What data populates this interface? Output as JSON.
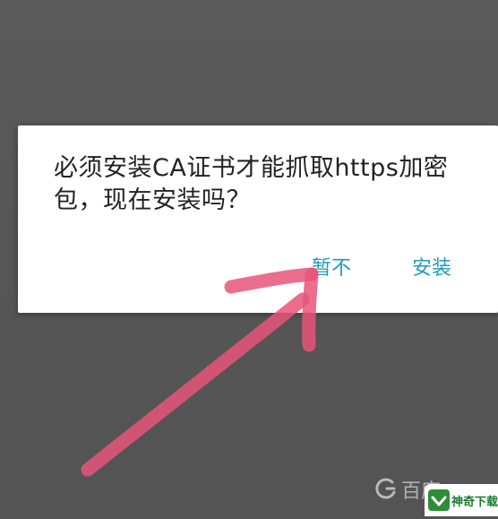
{
  "dialog": {
    "message": "必须安装CA证书才能抓取https加密包，现在安装吗？",
    "cancel_label": "暂不",
    "confirm_label": "安装"
  },
  "watermark": {
    "baidu_text": "百度",
    "badge_text": "神奇下载"
  },
  "colors": {
    "scrim": "#565656",
    "dialog_bg": "#ffffff",
    "message_text": "#222222",
    "button_text": "#1f9bb8",
    "annotation_arrow": "#e8557a"
  }
}
